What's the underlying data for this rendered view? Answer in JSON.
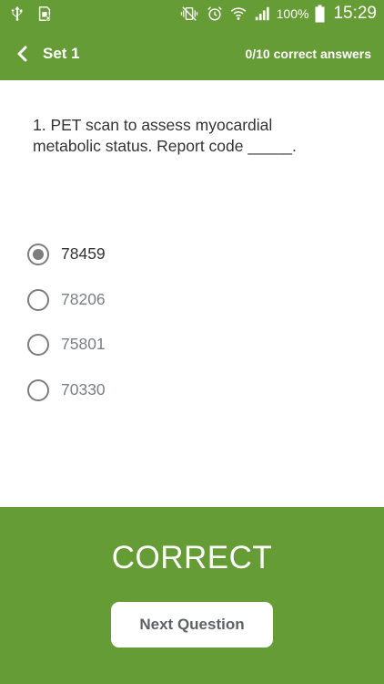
{
  "status_bar": {
    "left_icons": [
      "usb-icon",
      "sim-card-icon"
    ],
    "right_icons": [
      "vibrate-mute-icon",
      "alarm-icon",
      "wifi-icon",
      "signal-icon"
    ],
    "battery_percent": "100%",
    "time": "15:29"
  },
  "app_bar": {
    "back_icon": "chevron-left-icon",
    "title": "Set 1",
    "score": "0/10 correct answers"
  },
  "question": {
    "text": "1. PET scan to assess myocardial metabolic status. Report code _____."
  },
  "options": [
    {
      "label": "78459",
      "selected": true
    },
    {
      "label": "78206",
      "selected": false
    },
    {
      "label": "75801",
      "selected": false
    },
    {
      "label": "70330",
      "selected": false
    }
  ],
  "feedback": {
    "result": "CORRECT",
    "next_label": "Next Question"
  },
  "colors": {
    "primary_green": "#669c35",
    "text_dark": "#333333",
    "text_muted": "#7a7f86"
  }
}
